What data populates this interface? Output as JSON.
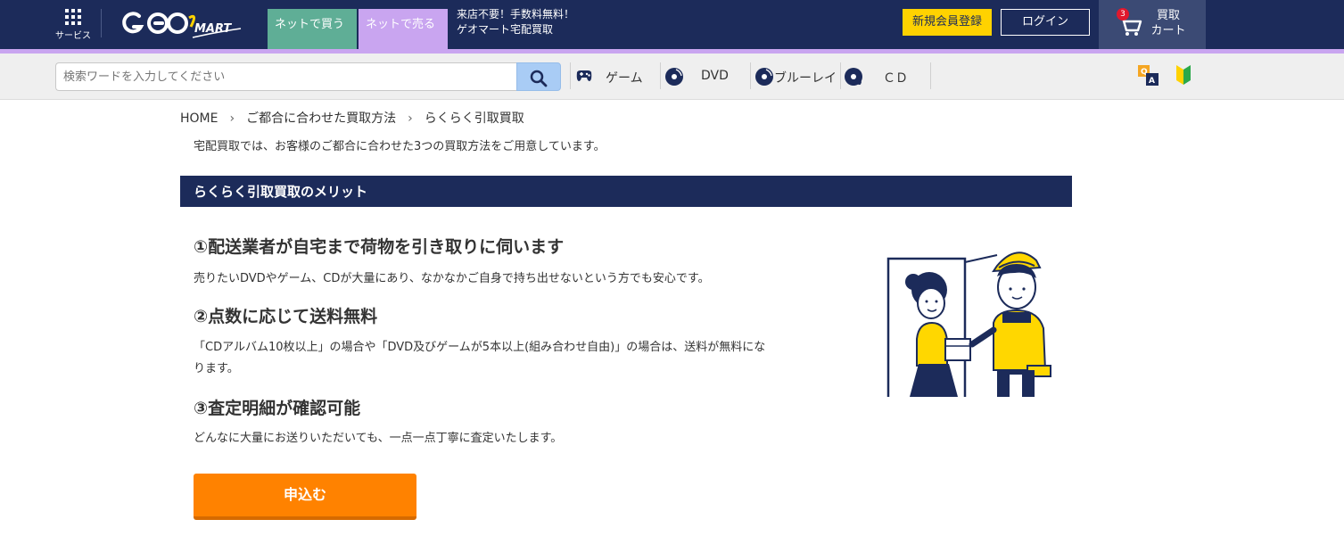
{
  "header": {
    "services_label": "サービス",
    "logo_text": "GEO MART",
    "tab_buy": "ネットで買う",
    "tab_sell": "ネットで売る",
    "promo_line1": "来店不要！手数料無料！",
    "promo_line2": "ゲオマート宅配買取",
    "register_label": "新規会員登録",
    "login_label": "ログイン",
    "cart_count": "3",
    "cart_line1": "買取",
    "cart_line2": "カート",
    "colors": {
      "navy": "#1c2b5a",
      "buy_tab": "#5fae96",
      "sell_tab": "#c9a5f0",
      "register": "#ffd200"
    }
  },
  "search": {
    "placeholder": "検索ワードを入力してください",
    "button_icon": "search-icon"
  },
  "nav": {
    "items": [
      {
        "label": "ゲーム",
        "icon": "gamepad-icon"
      },
      {
        "label": "DVD",
        "icon": "disc-icon"
      },
      {
        "label": "ブルーレイ",
        "icon": "bluray-disc-icon"
      },
      {
        "label": "ＣＤ",
        "icon": "music-disc-icon"
      }
    ],
    "right_icons": [
      "qa-icon",
      "beginner-mark-icon"
    ]
  },
  "breadcrumb": [
    "HOME",
    "ご都合に合わせた買取方法",
    "らくらく引取買取"
  ],
  "intro": "宅配買取では、お客様のご都合に合わせた3つの買取方法をご用意しています。",
  "section_title": "らくらく引取買取のメリット",
  "merits": [
    {
      "heading": "①配送業者が自宅まで荷物を引き取りに伺います",
      "text": "売りたいDVDやゲーム、CDが大量にあり、なかなかご自身で持ち出せないという方でも安心です。"
    },
    {
      "heading": "②点数に応じて送料無料",
      "text": "「CDアルバム10枚以上」の場合や「DVD及びゲームが5本以上(組み合わせ自由)」の場合は、送料が無料になります。"
    },
    {
      "heading": "③査定明細が確認可能",
      "text": "どんなに大量にお送りいただいても、一点一点丁寧に査定いたします。"
    }
  ],
  "apply_button": "申込む",
  "apply_color": "#ff8200"
}
